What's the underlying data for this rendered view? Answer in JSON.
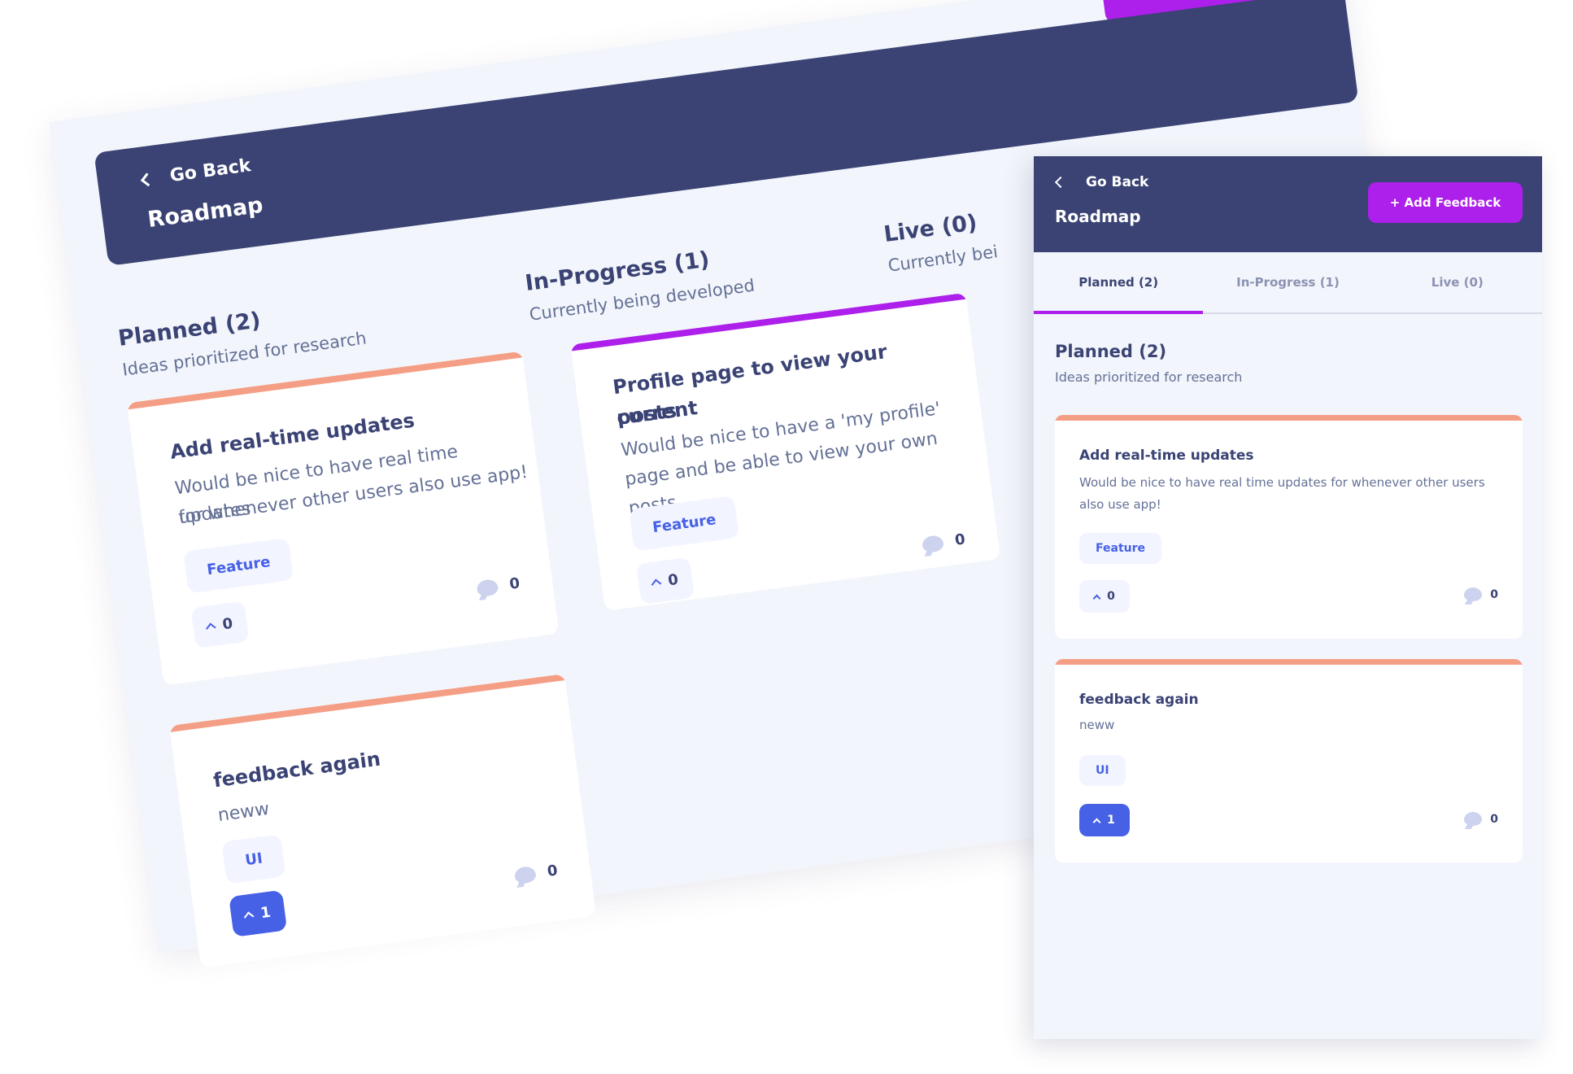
{
  "app": {
    "back_label": "Go Back",
    "title": "Roadmap",
    "add_feedback_label": "+ Add Feedback"
  },
  "colors": {
    "header": "#3a4374",
    "accent_purple": "#ad1fea",
    "blue": "#4661e6",
    "planned": "#f49f85",
    "in_progress": "#ad1fea",
    "live": "#62bcfa"
  },
  "columns": [
    {
      "title": "Planned (2)",
      "subtitle": "Ideas prioritized for research",
      "cards": [
        {
          "title": "Add real-time updates",
          "desc_lines": [
            "Would be nice to have real time updates",
            "for whenever other users also use app!"
          ],
          "desc": "Would be nice to have real time updates for whenever other users also use app!",
          "tag": "Feature",
          "votes": "0",
          "comments": "0",
          "upvoted": false
        },
        {
          "title": "feedback again",
          "desc_lines": [
            "neww"
          ],
          "desc": "neww",
          "tag": "UI",
          "votes": "1",
          "comments": "0",
          "upvoted": true
        }
      ]
    },
    {
      "title": "In-Progress (1)",
      "subtitle": "Currently being developed",
      "cards": [
        {
          "title_lines": [
            "Profile page to view your current",
            "posts"
          ],
          "desc_lines": [
            "Would be nice to have a 'my profile'",
            "page and be able to view your own posts"
          ],
          "tag": "Feature",
          "votes": "0",
          "comments": "0",
          "upvoted": false
        }
      ]
    },
    {
      "title": "Live (0)",
      "subtitle": "Currently bei"
    }
  ],
  "tabs": [
    {
      "label": "Planned (2)",
      "active": true
    },
    {
      "label": "In-Progress (1)",
      "active": false
    },
    {
      "label": "Live (0)",
      "active": false
    }
  ]
}
